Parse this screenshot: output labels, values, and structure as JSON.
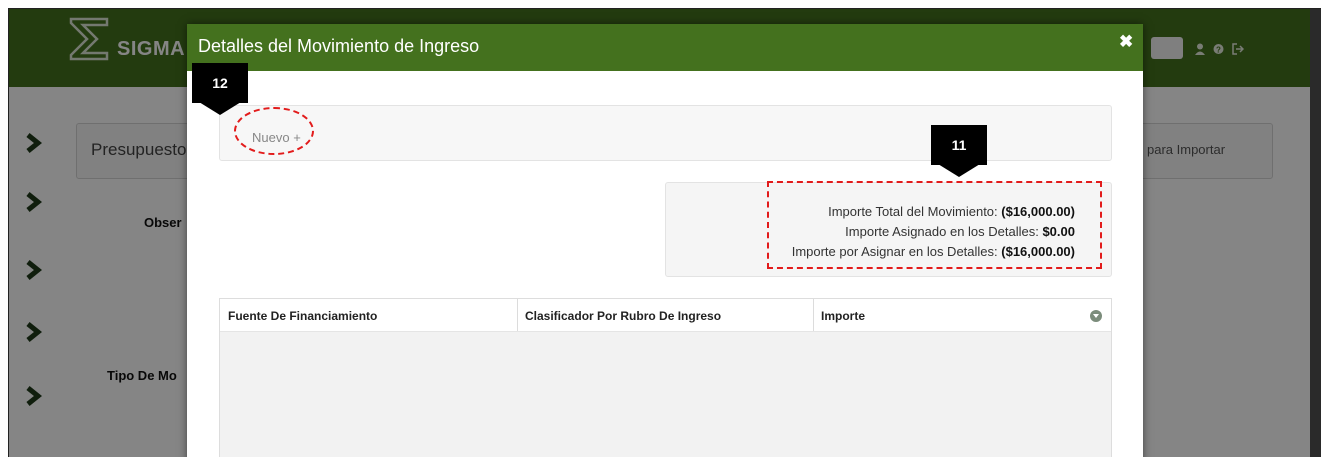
{
  "app": {
    "logo_text": "SIGMA",
    "panel_text": "Presupuesto",
    "import_label": "para Importar",
    "labels": {
      "observ": "Obser",
      "tipo": "Tipo De Mo"
    }
  },
  "modal": {
    "title": "Detalles del Movimiento de Ingreso",
    "close_symbol": "✖",
    "nuevo_label": "Nuevo +",
    "totals": {
      "total_label": "Importe Total del Movimiento: ",
      "total_value": "($16,000.00)",
      "assigned_label": "Importe Asignado en los Detalles: ",
      "assigned_value": "$0.00",
      "pending_label": "Importe por Asignar en los Detalles: ",
      "pending_value": "($16,000.00)"
    },
    "grid": {
      "columns": [
        "Fuente De Financiamiento",
        "Clasificador Por Rubro De Ingreso",
        "Importe"
      ]
    }
  },
  "annotations": {
    "callout_nuevo": "12",
    "callout_totals": "11",
    "highlight_color": "#e21b1b"
  },
  "colors": {
    "header_green": "#44711e"
  }
}
